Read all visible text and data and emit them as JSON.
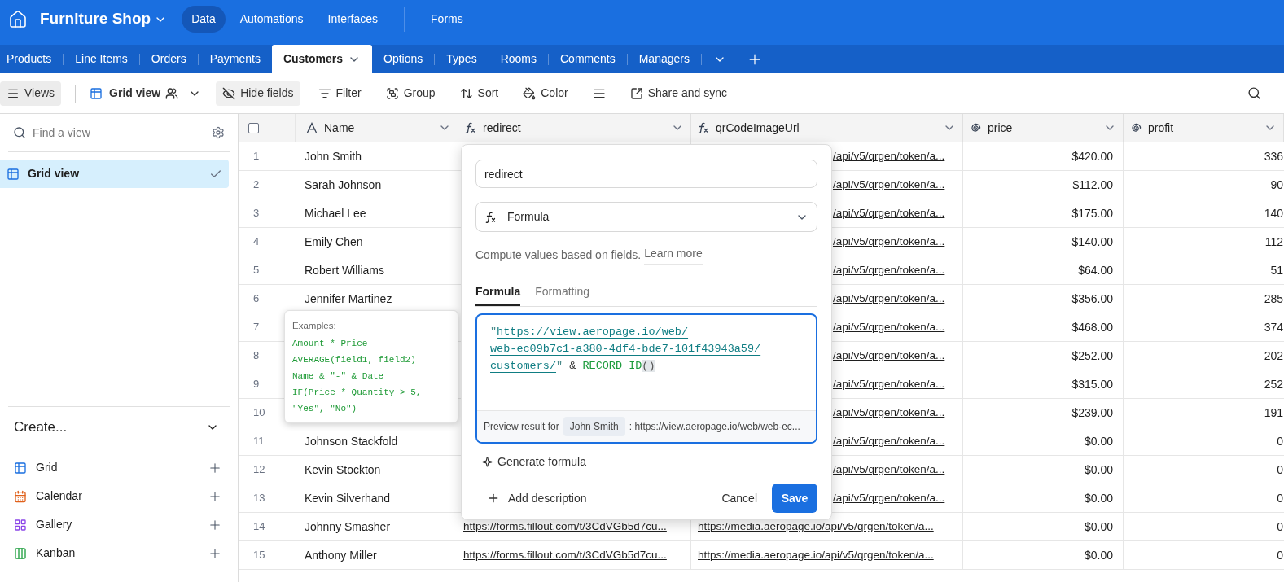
{
  "app": {
    "title": "Furniture Shop",
    "nav": [
      {
        "label": "Data",
        "selected": true
      },
      {
        "label": "Automations",
        "selected": false
      },
      {
        "label": "Interfaces",
        "selected": false
      },
      {
        "label": "Forms",
        "selected": false
      }
    ]
  },
  "tables": [
    {
      "label": "Products",
      "selected": false
    },
    {
      "label": "Line Items",
      "selected": false
    },
    {
      "label": "Orders",
      "selected": false
    },
    {
      "label": "Payments",
      "selected": false
    },
    {
      "label": "Customers",
      "selected": true
    },
    {
      "label": "Options",
      "selected": false
    },
    {
      "label": "Types",
      "selected": false
    },
    {
      "label": "Rooms",
      "selected": false
    },
    {
      "label": "Comments",
      "selected": false
    },
    {
      "label": "Managers",
      "selected": false
    }
  ],
  "toolbar": {
    "views": "Views",
    "view_name": "Grid view",
    "items": [
      {
        "kind": "hide",
        "label": "Hide fields",
        "active": true
      },
      {
        "kind": "filter",
        "label": "Filter",
        "active": false
      },
      {
        "kind": "group",
        "label": "Group",
        "active": false
      },
      {
        "kind": "sort",
        "label": "Sort",
        "active": false
      },
      {
        "kind": "color",
        "label": "Color",
        "active": false
      },
      {
        "kind": "rowheight",
        "active": false
      },
      {
        "kind": "share",
        "label": "Share and sync",
        "active": false
      }
    ]
  },
  "sidebar": {
    "search_placeholder": "Find a view",
    "views": [
      {
        "label": "Grid view",
        "selected": true
      }
    ],
    "create_title": "Create...",
    "create_items": [
      {
        "kind": "grid",
        "label": "Grid"
      },
      {
        "kind": "calendar",
        "label": "Calendar"
      },
      {
        "kind": "gallery",
        "label": "Gallery"
      },
      {
        "kind": "kanban",
        "label": "Kanban"
      }
    ]
  },
  "table": {
    "select_all_checked": false,
    "columns": [
      {
        "kind": "text",
        "label": "Name"
      },
      {
        "kind": "formula",
        "label": "redirect"
      },
      {
        "kind": "formula",
        "label": "qrCodeImageUrl"
      },
      {
        "kind": "number",
        "label": "price"
      },
      {
        "kind": "number",
        "label": "profit"
      }
    ],
    "rows": [
      {
        "number": "1",
        "name": "John Smith",
        "qr": "/api/v5/qrgen/token/a...",
        "price": "$420.00",
        "profit": "336"
      },
      {
        "number": "2",
        "name": "Sarah Johnson",
        "qr": "/api/v5/qrgen/token/a...",
        "price": "$112.00",
        "profit": "90"
      },
      {
        "number": "3",
        "name": "Michael Lee",
        "qr": "/api/v5/qrgen/token/a...",
        "price": "$175.00",
        "profit": "140"
      },
      {
        "number": "4",
        "name": "Emily Chen",
        "qr": "/api/v5/qrgen/token/a...",
        "price": "$140.00",
        "profit": "112"
      },
      {
        "number": "5",
        "name": "Robert Williams",
        "qr": "/api/v5/qrgen/token/a...",
        "price": "$64.00",
        "profit": "51"
      },
      {
        "number": "6",
        "name": "Jennifer Martinez",
        "qr": "/api/v5/qrgen/token/a...",
        "price": "$356.00",
        "profit": "285"
      },
      {
        "number": "7",
        "qr": "/api/v5/qrgen/token/a...",
        "price": "$468.00",
        "profit": "374"
      },
      {
        "number": "8",
        "qr": "/api/v5/qrgen/token/a...",
        "price": "$252.00",
        "profit": "202"
      },
      {
        "number": "9",
        "qr": "/api/v5/qrgen/token/a...",
        "price": "$315.00",
        "profit": "252"
      },
      {
        "number": "10",
        "qr": "/api/v5/qrgen/token/a...",
        "price": "$239.00",
        "profit": "191"
      },
      {
        "number": "11",
        "name": "Johnson Stackfold",
        "qr": "/api/v5/qrgen/token/a...",
        "price": "$0.00",
        "profit": "0"
      },
      {
        "number": "12",
        "name": "Kevin Stockton",
        "qr": "/api/v5/qrgen/token/a...",
        "price": "$0.00",
        "profit": "0"
      },
      {
        "number": "13",
        "name": "Kevin Silverhand",
        "qr": "/api/v5/qrgen/token/a...",
        "price": "$0.00",
        "profit": "0"
      },
      {
        "number": "14",
        "name": "Johnny Smasher",
        "redirect": "https://forms.fillout.com/t/3CdVGb5d7cu...",
        "qr": "https://media.aeropage.io/api/v5/qrgen/token/a...",
        "price": "$0.00",
        "profit": "0"
      },
      {
        "number": "15",
        "name": "Anthony Miller",
        "redirect": "https://forms.fillout.com/t/3CdVGb5d7cu...",
        "qr": "https://media.aeropage.io/api/v5/qrgen/token/a...",
        "price": "$0.00",
        "profit": "0"
      }
    ]
  },
  "tooltip": {
    "title": "Examples:",
    "lines": [
      "Amount * Price",
      "AVERAGE(field1, field2)",
      "Name & \"-\" & Date",
      "IF(Price * Quantity > 5,",
      "\"Yes\", \"No\")"
    ]
  },
  "field_editor": {
    "name": "redirect",
    "type": "Formula",
    "help": "Compute values based on fields.",
    "help_link": "Learn more",
    "tabs": [
      {
        "label": "Formula",
        "selected": true
      },
      {
        "label": "Formatting",
        "selected": false
      }
    ],
    "formula_lines": [
      [
        {
          "kind": "quote",
          "text": "\""
        },
        {
          "kind": "url",
          "text": "https://view.aeropage.io/web/"
        }
      ],
      [
        {
          "kind": "url",
          "text": "web-ec09b7c1-a380-4df4-bde7-101f43943a59/"
        }
      ],
      [
        {
          "kind": "url",
          "text": "customers/"
        },
        {
          "kind": "quote",
          "text": "\""
        },
        {
          "kind": "operator",
          "text": " & "
        },
        {
          "kind": "function",
          "text": "RECORD_ID"
        },
        {
          "kind": "paren",
          "text": "()"
        }
      ]
    ],
    "preview_label": "Preview result for",
    "preview_record": "John Smith",
    "preview_value": ": https://view.aeropage.io/web/web-ec...",
    "generate": "Generate formula",
    "add_description": "Add description",
    "cancel": "Cancel",
    "save": "Save"
  }
}
